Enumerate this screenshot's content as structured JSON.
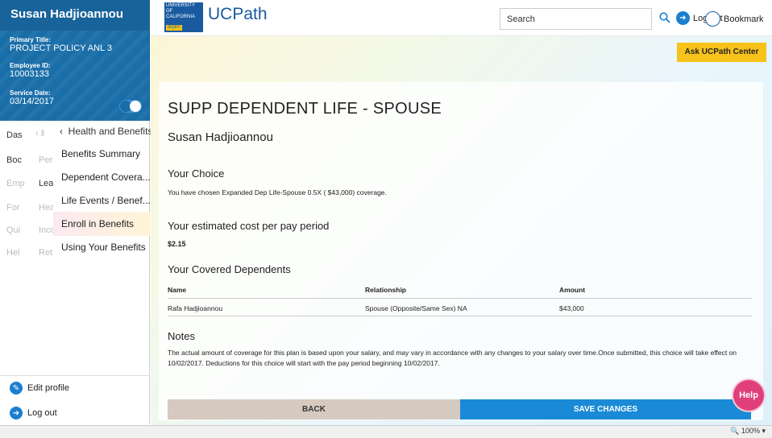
{
  "profile": {
    "name": "Susan Hadjioannou",
    "primary_title_label": "Primary Title:",
    "primary_title": "PROJECT POLICY ANL 3",
    "employee_id_label": "Employee ID:",
    "employee_id": "10003133",
    "service_date_label": "Service Date:",
    "service_date": "03/14/2017"
  },
  "nav": {
    "col1": [
      "Das",
      "Boc",
      "Emp",
      "For",
      "Qui",
      "Hel"
    ],
    "col2": [
      "Pers",
      "Lea",
      "Hea",
      "Inco",
      "Ret"
    ],
    "back_label": "Health and Benefits",
    "items": [
      "Benefits Summary",
      "Dependent Covera...",
      "Life Events / Benef...",
      "Enroll in Benefits",
      "Using Your Benefits"
    ]
  },
  "sidebar_bottom": {
    "edit_profile": "Edit profile",
    "log_out": "Log out"
  },
  "header": {
    "logo_text_1": "UNIVERSITY",
    "logo_text_2": "OF",
    "logo_text_3": "CALIFORNIA",
    "logo_sub": "drptrn",
    "brand": "UCPath",
    "search_placeholder": "Search",
    "logout": "Log out",
    "bookmark": "Bookmark",
    "ask": "Ask UCPath Center"
  },
  "main": {
    "title": "SUPP DEPENDENT LIFE - SPOUSE",
    "employee_name": "Susan Hadjioannou",
    "choice_heading": "Your Choice",
    "choice_text": "You have chosen Expanded Dep Life-Spouse 0.5X ( $43,000) coverage.",
    "cost_heading": "Your estimated cost per pay period",
    "cost_value": "$2.15",
    "dependents_heading": "Your Covered Dependents",
    "table": {
      "headers": [
        "Name",
        "Relationship",
        "Amount"
      ],
      "rows": [
        [
          "Rafa Hadjioannou",
          "Spouse (Opposite/Same Sex) NA",
          "$43,000"
        ]
      ]
    },
    "notes_heading": "Notes",
    "notes_text": "The actual amount of coverage for this plan is based upon your salary, and may vary in accordance with any changes to your salary over time.Once submitted, this choice will take effect on 10/02/2017. Deductions for this choice will start with the pay period beginning 10/02/2017."
  },
  "buttons": {
    "back": "BACK",
    "save": "SAVE CHANGES",
    "help": "Help"
  },
  "status": {
    "zoom": "100%"
  }
}
